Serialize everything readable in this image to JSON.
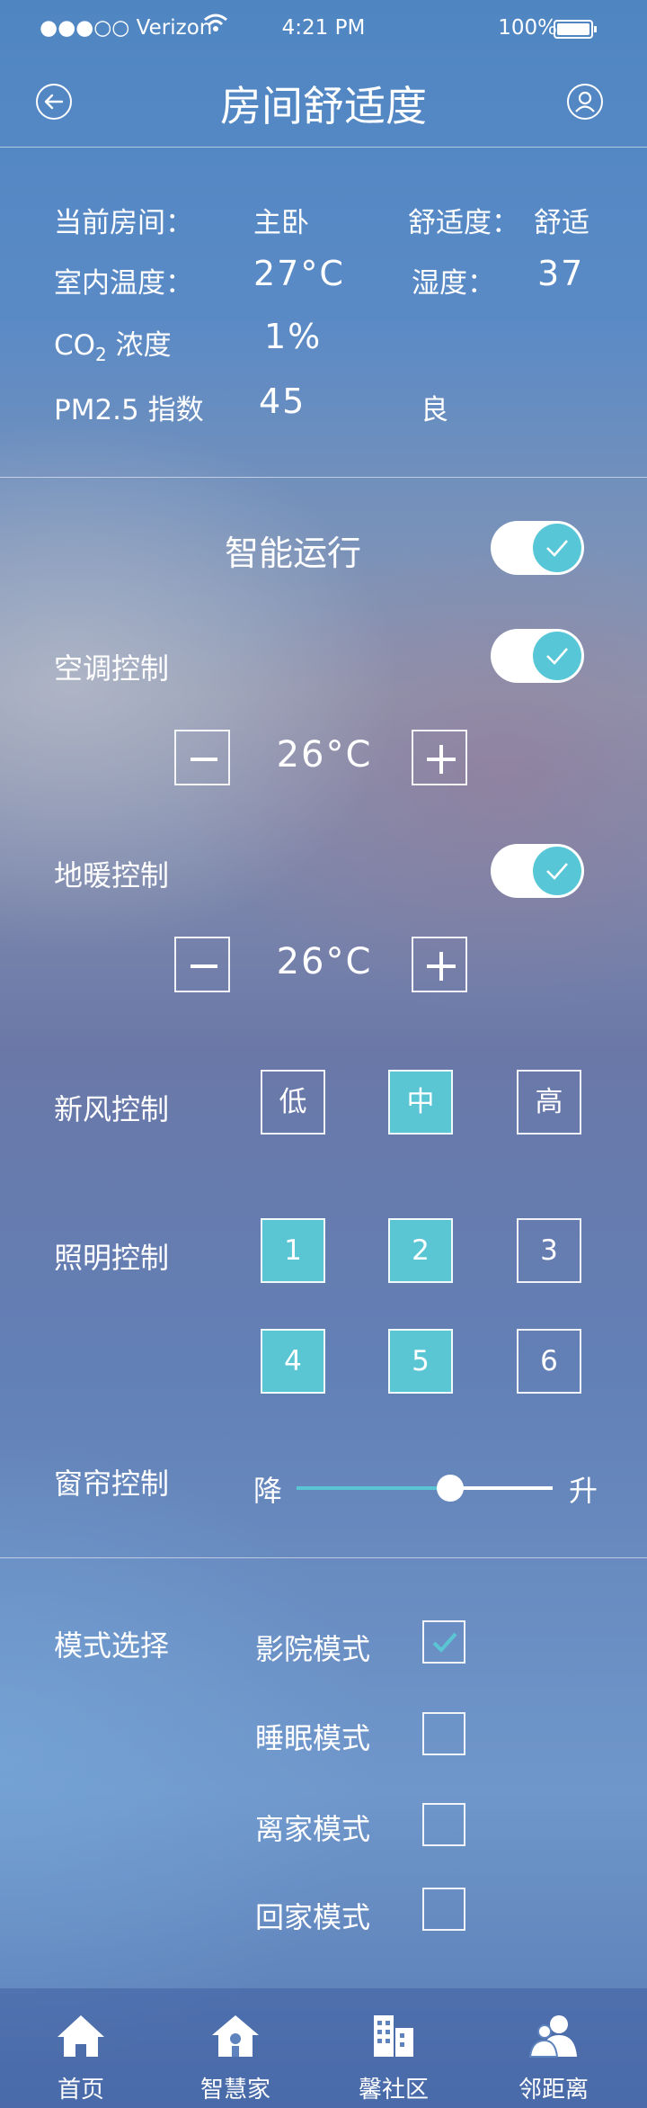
{
  "status_bar": {
    "signal": "●●●○○",
    "carrier": "Verizon",
    "time": "4:21 PM",
    "battery": "100%"
  },
  "header": {
    "title": "房间舒适度",
    "back_icon": "back-arrow-icon",
    "user_icon": "user-icon"
  },
  "info": {
    "room_label": "当前房间：",
    "room_value": "主卧",
    "comfort_label": "舒适度：",
    "comfort_value": "舒适",
    "temp_label": "室内温度：",
    "temp_value": "27°C",
    "humidity_label": "湿度：",
    "humidity_value": "37",
    "co2_label_main": "CO",
    "co2_label_sub": "2",
    "co2_label_rest": " 浓度",
    "co2_value": "1%",
    "pm_label": "PM2.5 指数",
    "pm_value": "45",
    "pm_grade": "良"
  },
  "controls": {
    "smart_run": {
      "label": "智能运行",
      "on": true
    },
    "ac": {
      "label": "空调控制",
      "on": true,
      "temp": "26°C"
    },
    "floor_heat": {
      "label": "地暖控制",
      "on": true,
      "temp": "26°C"
    },
    "fresh_air": {
      "label": "新风控制",
      "options": [
        "低",
        "中",
        "高"
      ],
      "selected": "中"
    },
    "lighting": {
      "label": "照明控制",
      "options": [
        "1",
        "2",
        "3",
        "4",
        "5",
        "6"
      ],
      "active": [
        "1",
        "2",
        "4",
        "5"
      ]
    },
    "curtain": {
      "label": "窗帘控制",
      "down_label": "降",
      "up_label": "升",
      "level": 0.6
    }
  },
  "modes": {
    "label": "模式选择",
    "items": [
      {
        "label": "影院模式",
        "checked": true
      },
      {
        "label": "睡眠模式",
        "checked": false
      },
      {
        "label": "离家模式",
        "checked": false
      },
      {
        "label": "回家模式",
        "checked": false
      }
    ]
  },
  "tabbar": {
    "items": [
      {
        "label": "首页",
        "icon": "home-icon"
      },
      {
        "label": "智慧家",
        "icon": "smart-home-icon"
      },
      {
        "label": "馨社区",
        "icon": "community-icon"
      },
      {
        "label": "邻距离",
        "icon": "neighbors-icon"
      }
    ]
  },
  "colors": {
    "accent": "#5ac6d4",
    "text": "#ffffff"
  }
}
